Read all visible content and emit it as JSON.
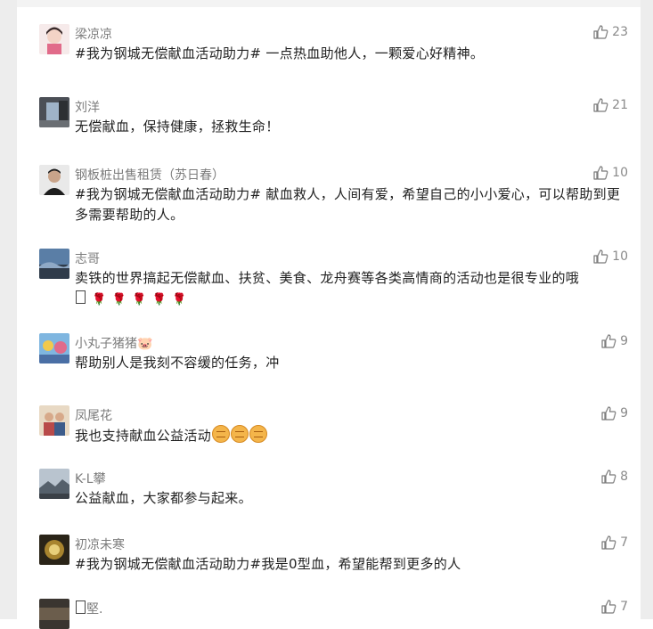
{
  "comments": [
    {
      "name": "梁凉凉",
      "text": "#我为钢城无偿献血活动助力# 一点热血助他人，一颗爱心好精神。",
      "likes": "23",
      "avatar": "avatar-girl-pink"
    },
    {
      "name": "刘洋",
      "text": "无偿献血，保持健康，拯救生命！",
      "likes": "21",
      "avatar": "avatar-room"
    },
    {
      "name": "钢板桩出售租赁（苏日春）",
      "text": "#我为钢城无偿献血活动助力#  献血救人，人间有爱，希望自己的小小爱心，可以帮助到更多需要帮助的人。",
      "likes": "10",
      "avatar": "avatar-man"
    },
    {
      "name": "志哥",
      "text": "卖铁的世界搞起无偿献血、扶贫、美食、龙舟赛等各类高情商的活动也是很专业的哦",
      "text2_prefix": "",
      "likes": "10",
      "avatar": "avatar-sky"
    },
    {
      "name": "小丸子猪猪🐷",
      "text": "帮助别人是我刻不容缓的任务，冲",
      "likes": "9",
      "avatar": "avatar-cartoon"
    },
    {
      "name": "凤尾花",
      "text": "我也支持献血公益活动",
      "likes": "9",
      "avatar": "avatar-couple"
    },
    {
      "name": "K-L攀",
      "text": "公益献血，大家都参与起来。",
      "likes": "8",
      "avatar": "avatar-landscape"
    },
    {
      "name": "初凉未寒",
      "text": "#我为钢城无偿献血活动助力#我是0型血，希望能帮到更多的人",
      "likes": "7",
      "avatar": "avatar-emblem"
    },
    {
      "name": "堅.",
      "name_prefix": "",
      "likes": "7",
      "avatar": "avatar-dark"
    }
  ],
  "icons": {
    "like": "thumbs-up-icon",
    "rose": "rose-icon",
    "fist": "fist-emoji-icon"
  },
  "colors": {
    "name": "#7b7b7b",
    "text": "#222222",
    "like": "#8a8a8a",
    "rose": "#d9262c"
  }
}
